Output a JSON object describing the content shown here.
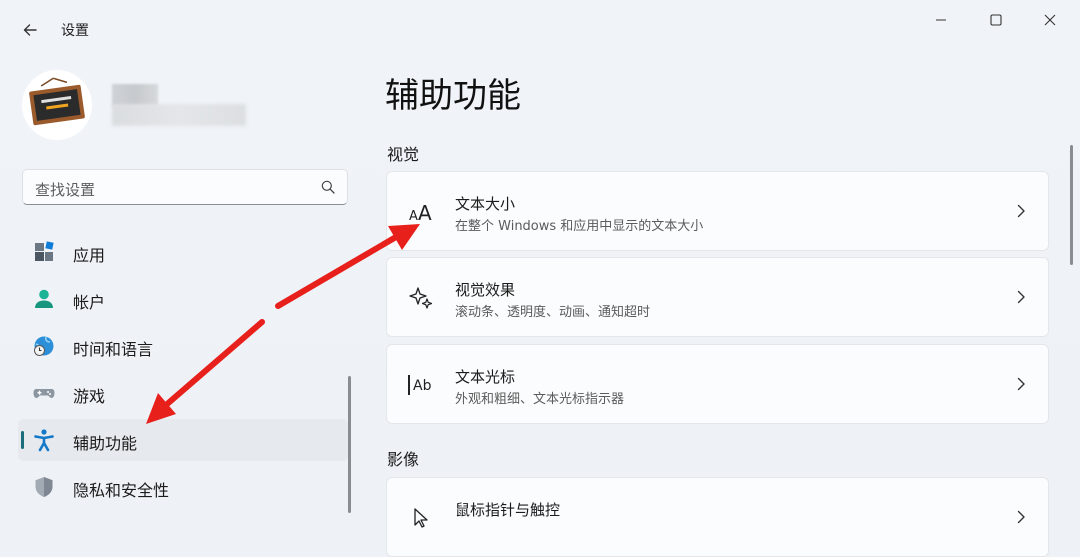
{
  "window": {
    "title": "设置"
  },
  "search": {
    "placeholder": "查找设置"
  },
  "sidebar": {
    "items": [
      {
        "label": "应用",
        "icon": "apps-icon"
      },
      {
        "label": "帐户",
        "icon": "account-icon"
      },
      {
        "label": "时间和语言",
        "icon": "time-language-icon"
      },
      {
        "label": "游戏",
        "icon": "gamepad-icon"
      },
      {
        "label": "辅助功能",
        "icon": "accessibility-icon",
        "selected": true
      },
      {
        "label": "隐私和安全性",
        "icon": "shield-icon"
      }
    ]
  },
  "main": {
    "title": "辅助功能",
    "sections": [
      {
        "title": "视觉",
        "cards": [
          {
            "title": "文本大小",
            "subtitle": "在整个 Windows 和应用中显示的文本大小",
            "icon": "text-size-icon"
          },
          {
            "title": "视觉效果",
            "subtitle": "滚动条、透明度、动画、通知超时",
            "icon": "sparkle-icon"
          },
          {
            "title": "文本光标",
            "subtitle": "外观和粗细、文本光标指示器",
            "icon": "text-cursor-icon"
          }
        ]
      },
      {
        "title": "影像",
        "cards": [
          {
            "title": "鼠标指针与触控",
            "subtitle": "",
            "icon": "mouse-pointer-icon"
          }
        ]
      }
    ]
  },
  "colors": {
    "accent": "#1a6d7a",
    "annotation_arrow": "#e8201c"
  }
}
